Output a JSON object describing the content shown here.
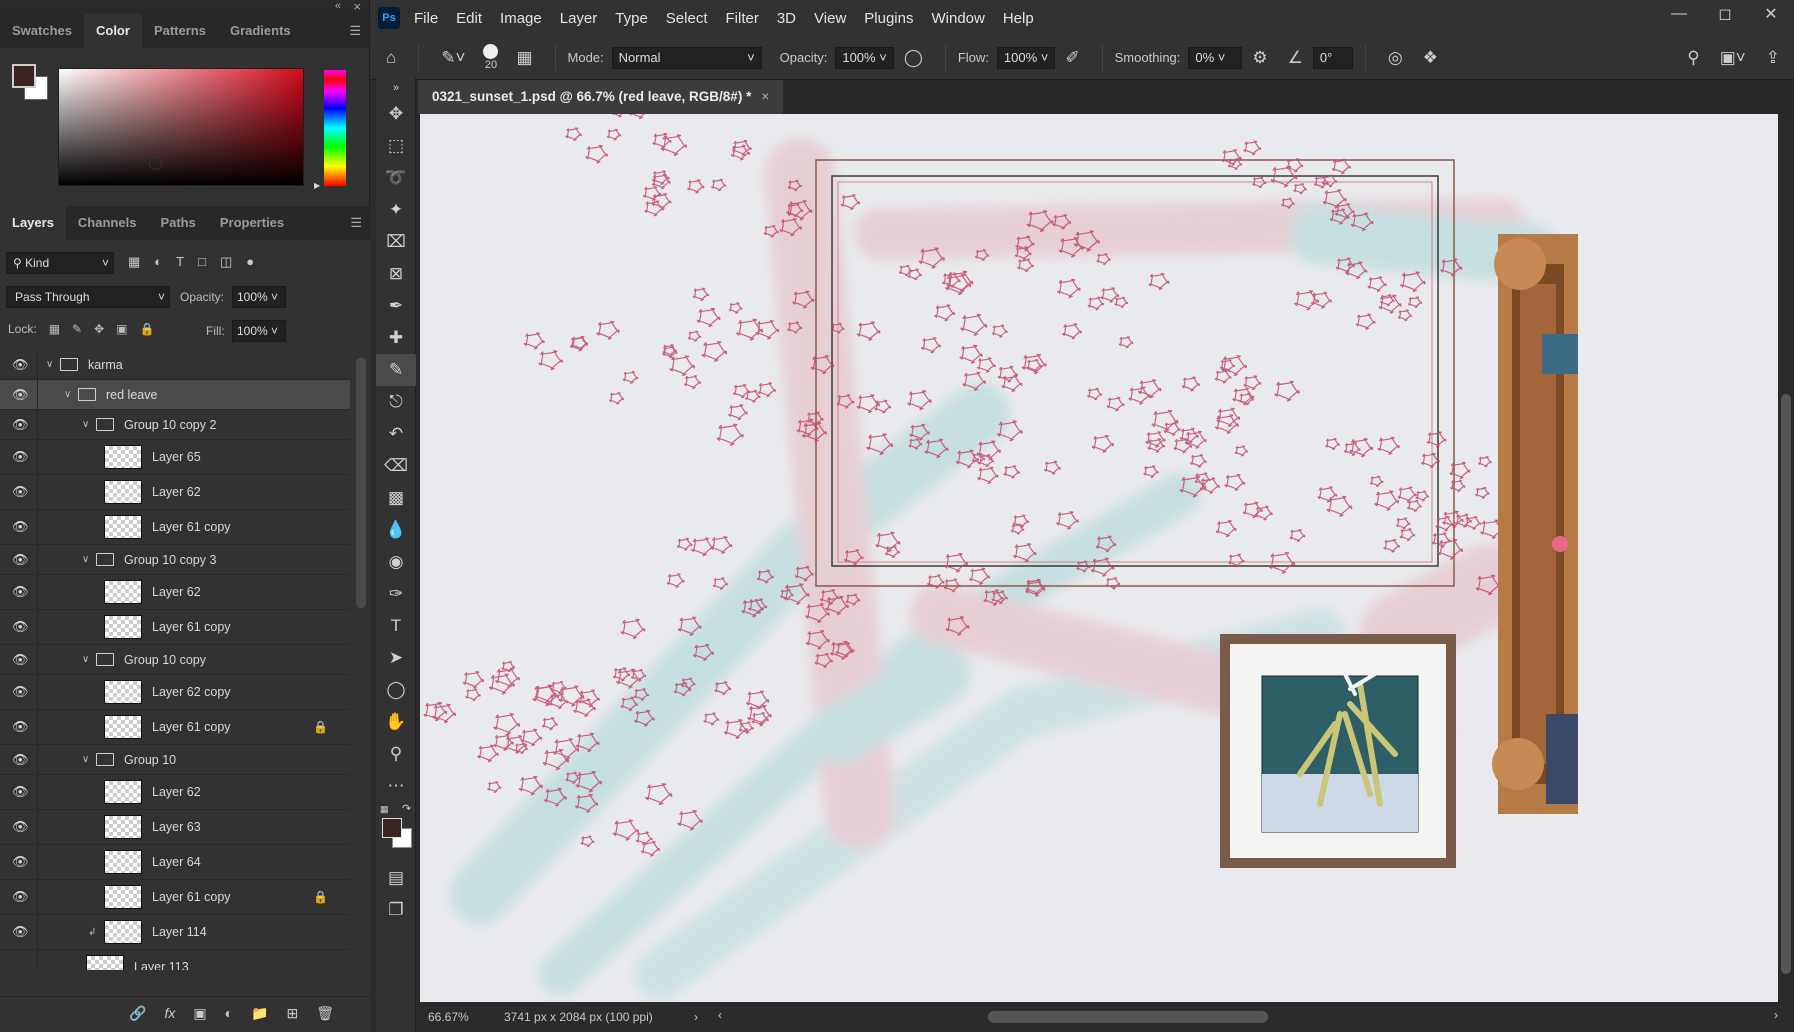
{
  "window": {
    "app_logo": "Ps",
    "menu": [
      "File",
      "Edit",
      "Image",
      "Layer",
      "Type",
      "Select",
      "Filter",
      "3D",
      "View",
      "Plugins",
      "Window",
      "Help"
    ]
  },
  "options": {
    "brush_size": "20",
    "mode_label": "Mode:",
    "mode_value": "Normal",
    "opacity_label": "Opacity:",
    "opacity_value": "100%",
    "flow_label": "Flow:",
    "flow_value": "100%",
    "smoothing_label": "Smoothing:",
    "smoothing_value": "0%",
    "angle_value": "0°"
  },
  "color_panel": {
    "tabs": [
      "Swatches",
      "Color",
      "Patterns",
      "Gradients"
    ],
    "active_tab": "Color",
    "foreground": "#3a2523",
    "background": "#ffffff"
  },
  "layers_panel": {
    "tabs": [
      "Layers",
      "Channels",
      "Paths",
      "Properties"
    ],
    "active_tab": "Layers",
    "filter_kind": "Kind",
    "blend_mode": "Pass Through",
    "opacity_label": "Opacity:",
    "opacity": "100%",
    "lock_label": "Lock:",
    "fill_label": "Fill:",
    "fill": "100%",
    "layers": [
      {
        "name": "karma",
        "type": "group",
        "depth": 0,
        "visible": true
      },
      {
        "name": "red leave",
        "type": "group",
        "depth": 1,
        "visible": true,
        "selected": true
      },
      {
        "name": "Group 10 copy 2",
        "type": "group",
        "depth": 2,
        "visible": true
      },
      {
        "name": "Layer 65",
        "type": "layer",
        "depth": 3,
        "visible": true
      },
      {
        "name": "Layer 62",
        "type": "layer",
        "depth": 3,
        "visible": true
      },
      {
        "name": "Layer 61 copy",
        "type": "layer",
        "depth": 3,
        "visible": true
      },
      {
        "name": "Group 10 copy 3",
        "type": "group",
        "depth": 2,
        "visible": true
      },
      {
        "name": "Layer 62",
        "type": "layer",
        "depth": 3,
        "visible": true
      },
      {
        "name": "Layer 61 copy",
        "type": "layer",
        "depth": 3,
        "visible": true
      },
      {
        "name": "Group 10 copy",
        "type": "group",
        "depth": 2,
        "visible": true
      },
      {
        "name": "Layer 62 copy",
        "type": "layer",
        "depth": 3,
        "visible": true
      },
      {
        "name": "Layer 61 copy",
        "type": "layer",
        "depth": 3,
        "visible": true,
        "locked": true
      },
      {
        "name": "Group 10",
        "type": "group",
        "depth": 2,
        "visible": true
      },
      {
        "name": "Layer 62",
        "type": "layer",
        "depth": 3,
        "visible": true
      },
      {
        "name": "Layer 63",
        "type": "layer",
        "depth": 3,
        "visible": true
      },
      {
        "name": "Layer 64",
        "type": "layer",
        "depth": 3,
        "visible": true
      },
      {
        "name": "Layer 61 copy",
        "type": "layer",
        "depth": 3,
        "visible": true,
        "locked": true
      },
      {
        "name": "Layer 114",
        "type": "layer",
        "depth": 3,
        "visible": true,
        "clipped": true
      },
      {
        "name": "Layer 113",
        "type": "layer",
        "depth": 2,
        "visible": false
      }
    ]
  },
  "document": {
    "tab_title": "0321_sunset_1.psd @ 66.7% (red leave, RGB/8#) *",
    "zoom": "66.67%",
    "info": "3741 px x 2084 px (100 ppi)"
  }
}
